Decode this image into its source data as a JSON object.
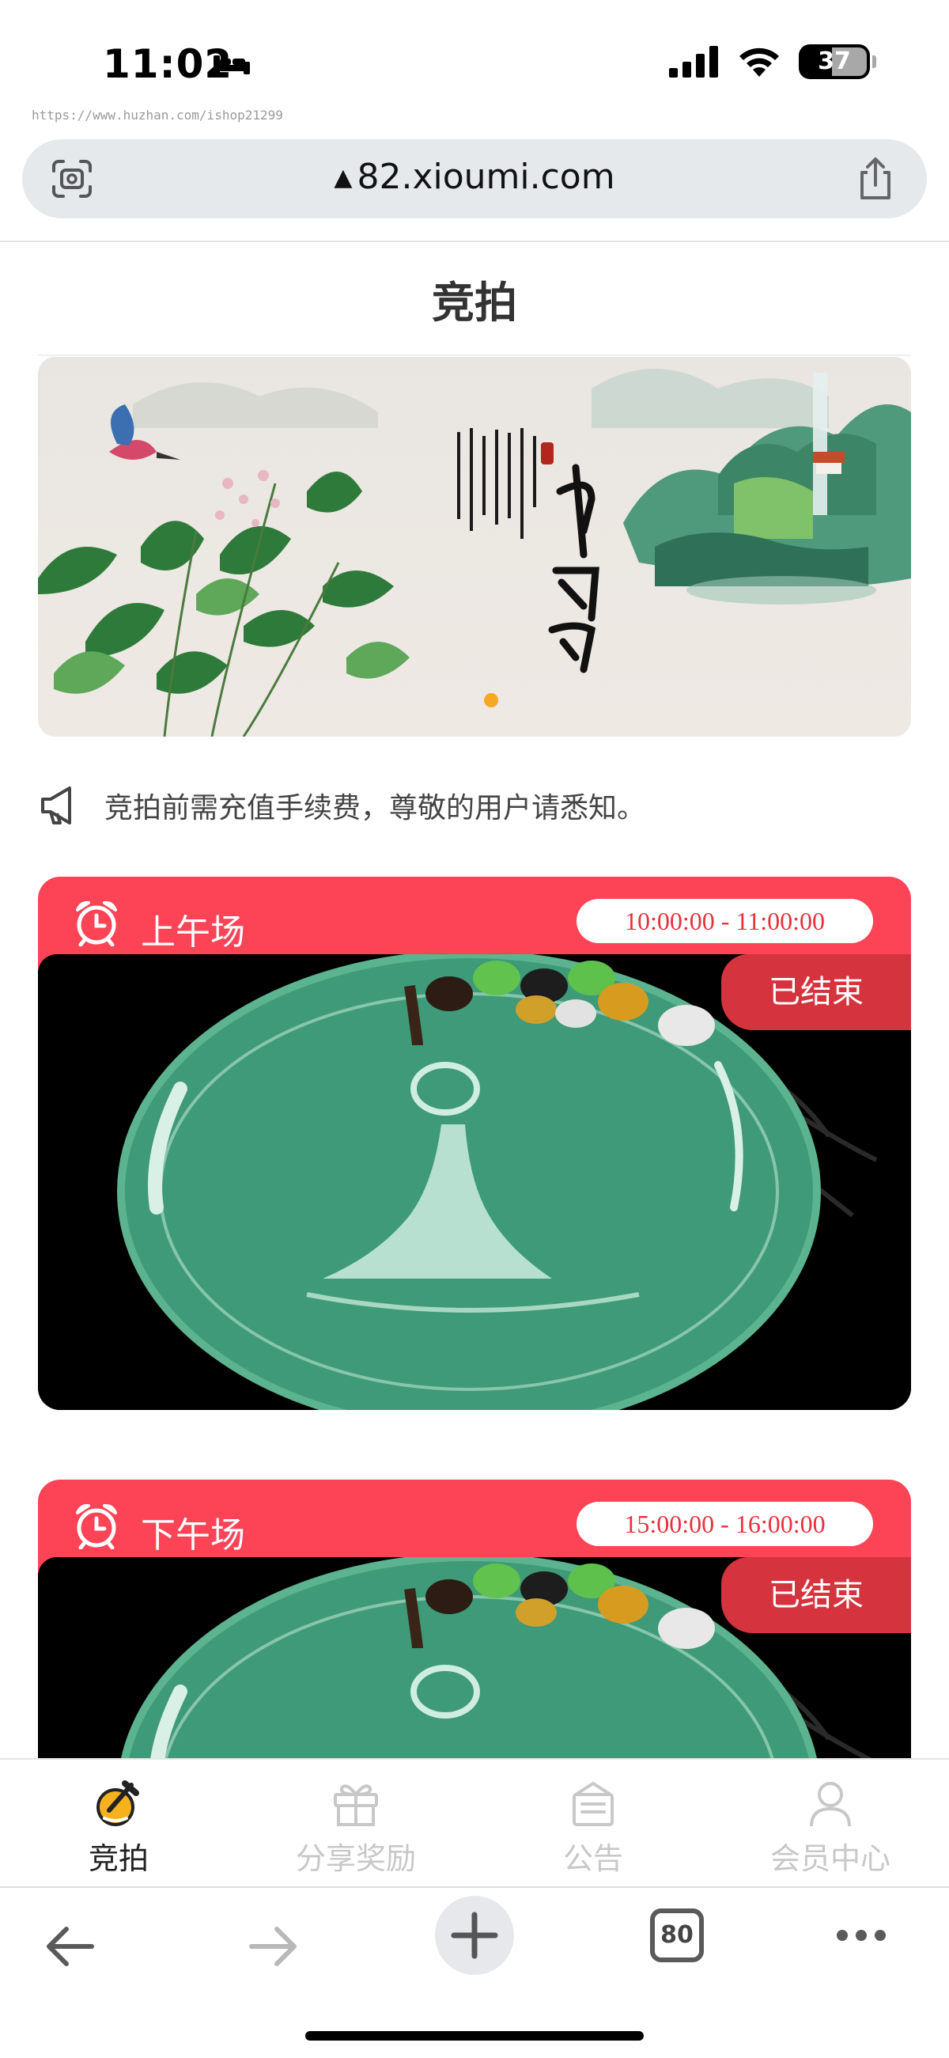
{
  "status_bar": {
    "time": "11:02",
    "battery": "37",
    "watermark": "https://www.huzhan.com/ishop21299"
  },
  "browser": {
    "url": "82.xioumi.com",
    "tab_count": "80"
  },
  "page": {
    "title": "竞拍"
  },
  "banner": {
    "slide_count": 1,
    "active_slide": 1
  },
  "notice": {
    "text": "竞拍前需充值手续费，尊敬的用户请悉知。"
  },
  "sessions": [
    {
      "label": "上午场",
      "time": "10:00:00 - 11:00:00",
      "status": "已结束"
    },
    {
      "label": "下午场",
      "time": "15:00:00 - 16:00:00",
      "status": "已结束"
    }
  ],
  "tab_bar": {
    "items": [
      {
        "label": "竞拍",
        "icon": "auction-icon",
        "active": true
      },
      {
        "label": "分享奖励",
        "icon": "gift-icon",
        "active": false
      },
      {
        "label": "公告",
        "icon": "announcement-icon",
        "active": false
      },
      {
        "label": "会员中心",
        "icon": "user-icon",
        "active": false
      }
    ]
  },
  "colors": {
    "accent": "#fd4457",
    "ended_tag": "#d5343e",
    "time_text": "#e8313d",
    "banner_dot": "#f6a823"
  }
}
